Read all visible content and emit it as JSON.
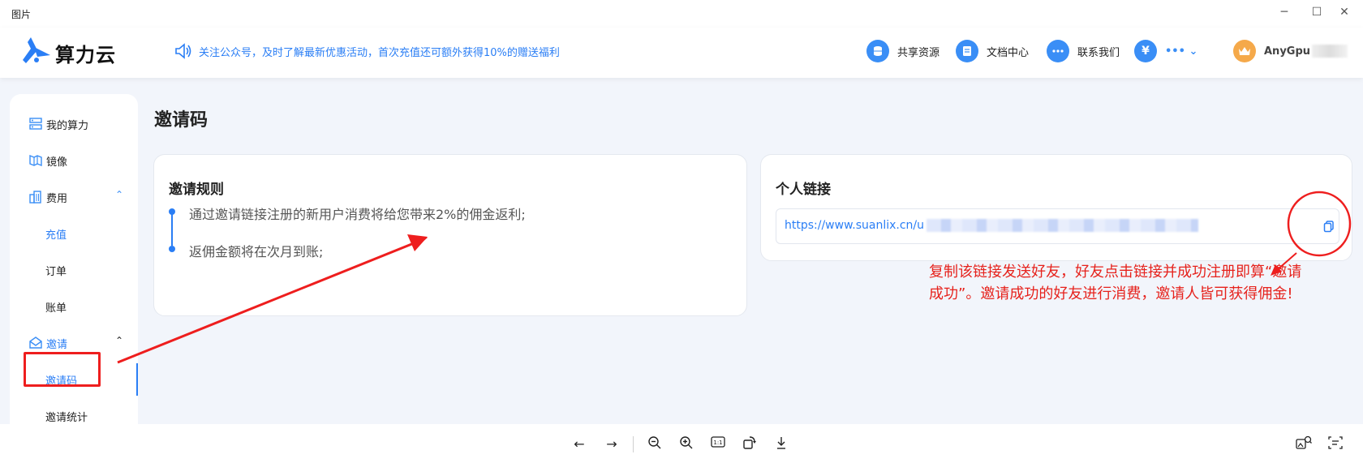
{
  "window": {
    "title": "图片"
  },
  "header": {
    "logo_text": "算力云",
    "notice": "关注公众号，及时了解最新优惠活动，首次充值还可额外获得10%的赠送福利",
    "nav": [
      {
        "label": "共享资源",
        "icon": "database-icon"
      },
      {
        "label": "文档中心",
        "icon": "document-icon"
      },
      {
        "label": "联系我们",
        "icon": "chat-icon"
      },
      {
        "label": "•••  ⌄",
        "icon": "yen-icon"
      }
    ],
    "user": {
      "name": "AnyGpu"
    }
  },
  "sidebar": {
    "items": [
      {
        "label": "我的算力",
        "icon": "compute-icon"
      },
      {
        "label": "镜像",
        "icon": "image-icon"
      },
      {
        "label": "费用",
        "icon": "building-icon",
        "expanded": true
      },
      {
        "label": "充值"
      },
      {
        "label": "订单"
      },
      {
        "label": "账单"
      },
      {
        "label": "邀请",
        "icon": "mail-icon",
        "expanded": true
      },
      {
        "label": "邀请码",
        "active": true
      },
      {
        "label": "邀请统计"
      }
    ]
  },
  "main": {
    "title": "邀请码",
    "rules": {
      "title": "邀请规则",
      "items": [
        "通过邀请链接注册的新用户消费将给您带来2%的佣金返利;",
        "返佣金额将在次月到账;"
      ]
    },
    "link": {
      "title": "个人链接",
      "url": "https://www.suanlix.cn/u"
    }
  },
  "annotation": {
    "text": "复制该链接发送好友，好友点击链接并成功注册即算“邀请成功”。邀请成功的好友进行消费，邀请人皆可获得佣金!",
    "color": "#e6221c"
  },
  "colors": {
    "accent": "#2a7ef5",
    "annotation": "#ee1e1e"
  }
}
